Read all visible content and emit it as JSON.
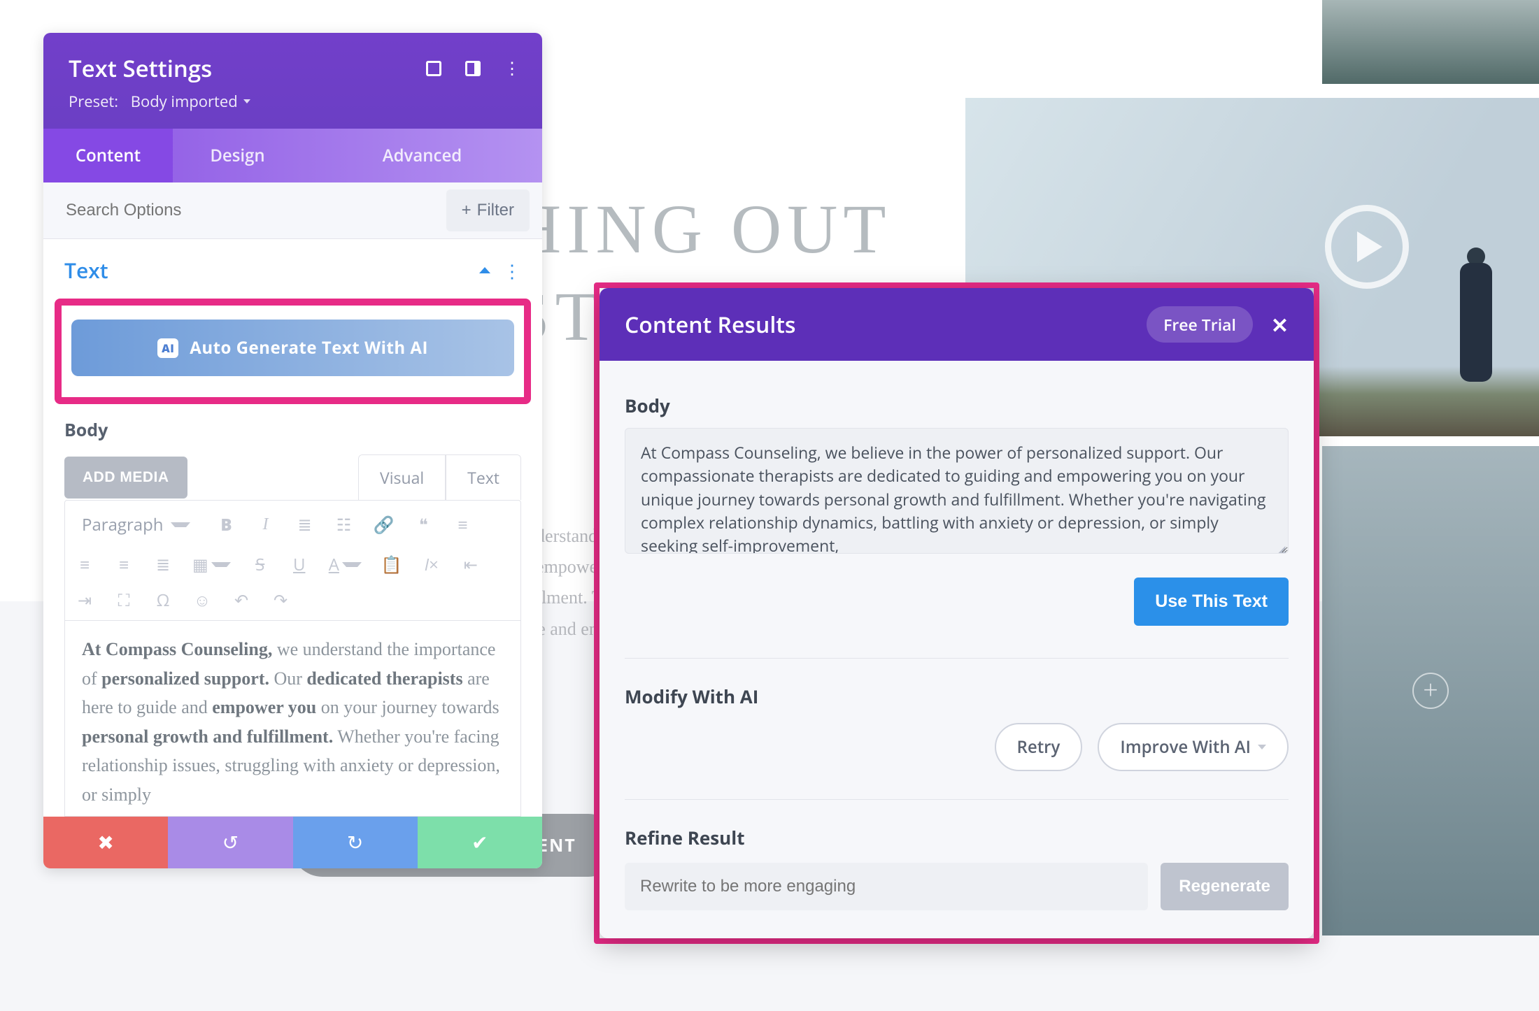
{
  "bg": {
    "heading_line1": "HING OUT",
    "heading_line2": "ST IN",
    "paragraph": "e understand individualized care. Our dedicated therapists are here to guide and empower you on your journey together towards growth, healing and fulfillment. The compassion you deserve, the outcomes you can expect, in a space and environment transformative, confidential and safe.",
    "book_button": "BOOK AN APPOINTMENT"
  },
  "panel": {
    "title": "Text Settings",
    "preset_label": "Preset:",
    "preset_value": "Body imported",
    "tabs": {
      "content": "Content",
      "design": "Design",
      "advanced": "Advanced"
    },
    "search_placeholder": "Search Options",
    "filter_label": "Filter",
    "section_title": "Text",
    "ai_button": "Auto Generate Text With AI",
    "body_label": "Body",
    "add_media": "ADD MEDIA",
    "visual_tab": "Visual",
    "text_tab": "Text",
    "paragraph_select": "Paragraph",
    "editor_text_bold1": "At Compass Counseling,",
    "editor_text_plain1": " we understand the importance of ",
    "editor_text_bold2": "personalized support.",
    "editor_text_plain2": " Our ",
    "editor_text_bold3": "dedicated therapists",
    "editor_text_plain3": " are here to guide and ",
    "editor_text_bold4": "empower you",
    "editor_text_plain4": " on your journey towards ",
    "editor_text_bold5": "personal growth and fulfillment.",
    "editor_text_plain5": " Whether you're facing relationship issues, struggling with anxiety or depression, or simply"
  },
  "modal": {
    "title": "Content Results",
    "trial": "Free Trial",
    "body_label": "Body",
    "body_text": "At Compass Counseling, we believe in the power of personalized support. Our compassionate therapists are dedicated to guiding and empowering you on your unique journey towards personal growth and fulfillment. Whether you're navigating complex relationship dynamics, battling with anxiety or depression, or simply seeking self-improvement,",
    "use_btn": "Use This Text",
    "modify_label": "Modify With AI",
    "retry_btn": "Retry",
    "improve_btn": "Improve With AI",
    "refine_label": "Refine Result",
    "refine_placeholder": "Rewrite to be more engaging",
    "regenerate_btn": "Regenerate"
  }
}
